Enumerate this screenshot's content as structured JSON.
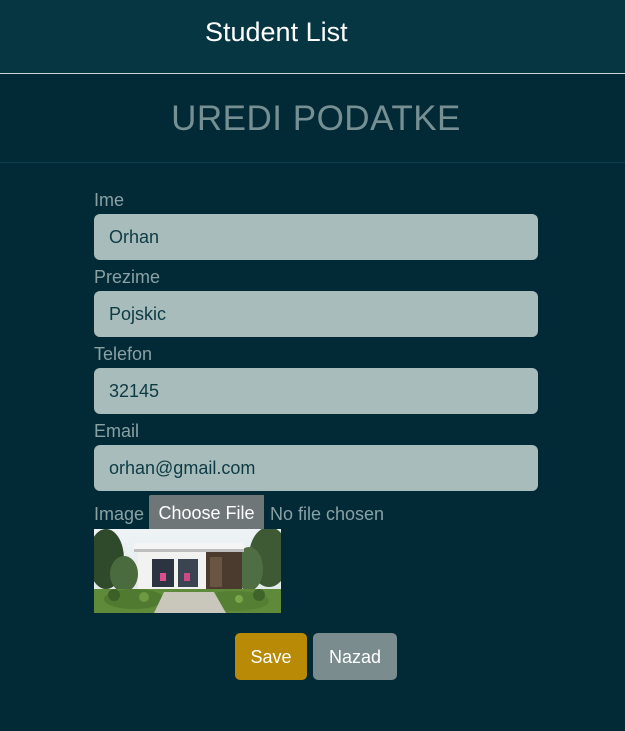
{
  "header": {
    "title": "Student List"
  },
  "page": {
    "heading": "UREDI PODATKE"
  },
  "form": {
    "fields": [
      {
        "label": "Ime",
        "value": "Orhan"
      },
      {
        "label": "Prezime",
        "value": "Pojskic"
      },
      {
        "label": "Telefon",
        "value": "32145"
      },
      {
        "label": "Email",
        "value": "orhan@gmail.com"
      }
    ],
    "image": {
      "label": "Image",
      "choose_button": "Choose File",
      "status": "No file chosen"
    }
  },
  "actions": {
    "save_label": "Save",
    "back_label": "Nazad",
    "save_color": "#b88a06",
    "back_color": "#7a8c8d"
  },
  "colors": {
    "background": "#012a36",
    "topbar": "#053642",
    "input_background": "#a7bcbb"
  }
}
